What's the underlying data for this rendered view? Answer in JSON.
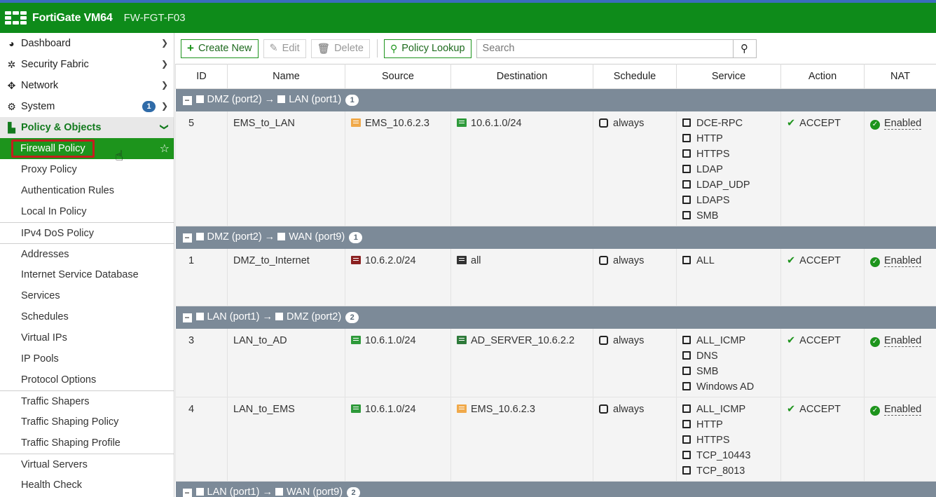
{
  "header": {
    "brand": "FortiGate VM64",
    "hostname": "FW-FGT-F03"
  },
  "sidebar": {
    "top": [
      {
        "label": "Dashboard",
        "icon": "dashboard-icon"
      },
      {
        "label": "Security Fabric",
        "icon": "fabric-icon"
      },
      {
        "label": "Network",
        "icon": "network-icon"
      },
      {
        "label": "System",
        "icon": "gear-icon",
        "badge": "1"
      }
    ],
    "section": {
      "label": "Policy & Objects",
      "icon": "policy-icon"
    },
    "groups": [
      [
        "Firewall Policy",
        "Proxy Policy",
        "Authentication Rules",
        "Local In Policy"
      ],
      [
        "IPv4 DoS Policy"
      ],
      [
        "Addresses",
        "Internet Service Database",
        "Services",
        "Schedules",
        "Virtual IPs",
        "IP Pools",
        "Protocol Options"
      ],
      [
        "Traffic Shapers",
        "Traffic Shaping Policy",
        "Traffic Shaping Profile"
      ],
      [
        "Virtual Servers",
        "Health Check"
      ]
    ]
  },
  "toolbar": {
    "create_new": "Create New",
    "edit": "Edit",
    "delete": "Delete",
    "policy_lookup": "Policy Lookup",
    "search_placeholder": "Search"
  },
  "table": {
    "columns": [
      "ID",
      "Name",
      "Source",
      "Destination",
      "Schedule",
      "Service",
      "Action",
      "NAT"
    ],
    "groups": [
      {
        "from": "DMZ (port2)",
        "to": "LAN (port1)",
        "count": "1",
        "rows": [
          {
            "id": "5",
            "name": "EMS_to_LAN",
            "source": [
              {
                "text": "EMS_10.6.2.3",
                "color": "#f0a94a"
              }
            ],
            "destination": [
              {
                "text": "10.6.1.0/24",
                "color": "#2e9a3a"
              }
            ],
            "schedule": "always",
            "service": [
              "DCE-RPC",
              "HTTP",
              "HTTPS",
              "LDAP",
              "LDAP_UDP",
              "LDAPS",
              "SMB"
            ],
            "action": "ACCEPT",
            "nat": "Enabled",
            "height": 164
          }
        ]
      },
      {
        "from": "DMZ (port2)",
        "to": "WAN (port9)",
        "count": "1",
        "rows": [
          {
            "id": "1",
            "name": "DMZ_to_Internet",
            "source": [
              {
                "text": "10.6.2.0/24",
                "color": "#8b2020"
              }
            ],
            "destination": [
              {
                "text": "all",
                "color": "#333333"
              }
            ],
            "schedule": "always",
            "service": [
              "ALL"
            ],
            "action": "ACCEPT",
            "nat": "Enabled",
            "height": 82
          }
        ]
      },
      {
        "from": "LAN (port1)",
        "to": "DMZ (port2)",
        "count": "2",
        "rows": [
          {
            "id": "3",
            "name": "LAN_to_AD",
            "source": [
              {
                "text": "10.6.1.0/24",
                "color": "#2e9a3a"
              }
            ],
            "destination": [
              {
                "text": "AD_SERVER_10.6.2.2",
                "color": "#2e7a3a"
              }
            ],
            "schedule": "always",
            "service": [
              "ALL_ICMP",
              "DNS",
              "SMB",
              "Windows AD"
            ],
            "action": "ACCEPT",
            "nat": "Enabled",
            "height": 98
          },
          {
            "id": "4",
            "name": "LAN_to_EMS",
            "source": [
              {
                "text": "10.6.1.0/24",
                "color": "#2e9a3a"
              }
            ],
            "destination": [
              {
                "text": "EMS_10.6.2.3",
                "color": "#f0a94a"
              }
            ],
            "schedule": "always",
            "service": [
              "ALL_ICMP",
              "HTTP",
              "HTTPS",
              "TCP_10443",
              "TCP_8013"
            ],
            "action": "ACCEPT",
            "nat": "Enabled",
            "height": 120
          }
        ]
      },
      {
        "from": "LAN (port1)",
        "to": "WAN (port9)",
        "count": "2",
        "rows": []
      }
    ]
  }
}
